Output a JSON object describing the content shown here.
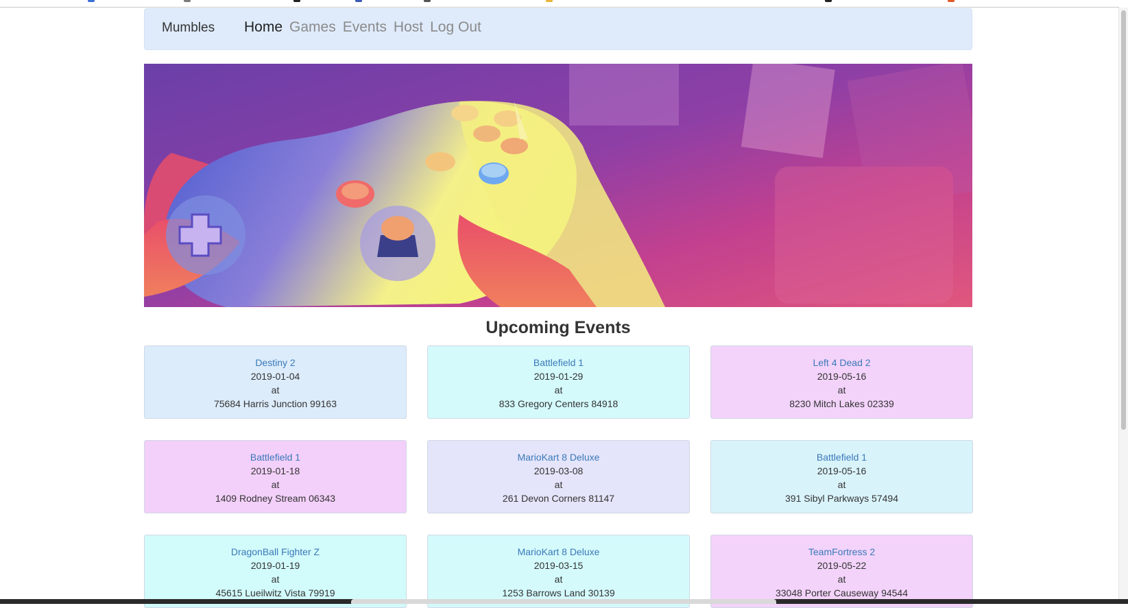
{
  "navbar": {
    "brand": "Mumbles",
    "links": [
      {
        "label": "Home",
        "active": true
      },
      {
        "label": "Games",
        "active": false
      },
      {
        "label": "Events",
        "active": false
      },
      {
        "label": "Host",
        "active": false
      },
      {
        "label": "Log Out",
        "active": false
      }
    ]
  },
  "hero": {
    "image": "retro-game-controller-banner"
  },
  "events_section": {
    "title": "Upcoming Events",
    "at_word": "at",
    "events": [
      {
        "game": "Destiny 2",
        "date": "2019-01-04",
        "address": "75684 Harris Junction 99163",
        "color": "#dcecfb"
      },
      {
        "game": "Battlefield 1",
        "date": "2019-01-29",
        "address": "833 Gregory Centers 84918",
        "color": "#d4fafc"
      },
      {
        "game": "Left 4 Dead 2",
        "date": "2019-05-16",
        "address": "8230 Mitch Lakes 02339",
        "color": "#f3d3fa"
      },
      {
        "game": "Battlefield 1",
        "date": "2019-01-18",
        "address": "1409 Rodney Stream 06343",
        "color": "#f3d0fa"
      },
      {
        "game": "MarioKart 8 Deluxe",
        "date": "2019-03-08",
        "address": "261 Devon Corners 81147",
        "color": "#e4e4fa"
      },
      {
        "game": "Battlefield 1",
        "date": "2019-05-16",
        "address": "391 Sibyl Parkways 57494",
        "color": "#d9f3fb"
      },
      {
        "game": "DragonBall Fighter Z",
        "date": "2019-01-19",
        "address": "45615 Lueilwitz Vista 79919",
        "color": "#d2fbfb"
      },
      {
        "game": "MarioKart 8 Deluxe",
        "date": "2019-03-15",
        "address": "1253 Barrows Land 30139",
        "color": "#d4fafc"
      },
      {
        "game": "TeamFortress 2",
        "date": "2019-05-22",
        "address": "33048 Porter Causeway 94544",
        "color": "#f3d3fa"
      }
    ]
  }
}
